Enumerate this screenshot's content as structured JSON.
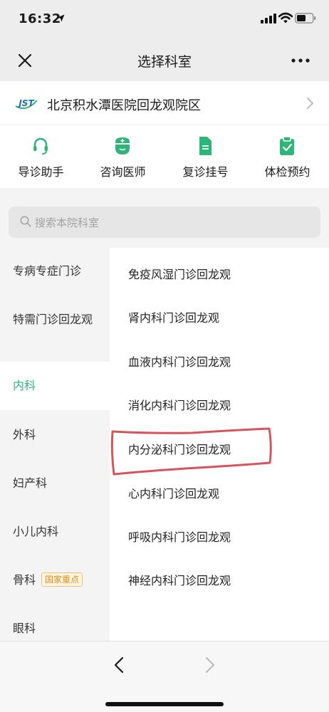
{
  "status": {
    "time": "16:32"
  },
  "nav": {
    "title": "选择科室"
  },
  "hospital": {
    "name": "北京积水潭医院回龙观院区",
    "logo_text": "JST"
  },
  "services": [
    {
      "label": "导诊助手",
      "icon": "headset-icon"
    },
    {
      "label": "咨询医师",
      "icon": "doctor-icon"
    },
    {
      "label": "复诊挂号",
      "icon": "document-icon"
    },
    {
      "label": "体检预约",
      "icon": "clipboard-check-icon"
    }
  ],
  "search": {
    "placeholder": "搜索本院科室"
  },
  "departments": [
    {
      "label": "专病专症门诊"
    },
    {
      "label": "特需门诊回龙观"
    },
    {
      "label": "内科",
      "active": true
    },
    {
      "label": "外科"
    },
    {
      "label": "妇产科"
    },
    {
      "label": "小儿内科"
    },
    {
      "label": "骨科",
      "badge": "国家重点"
    },
    {
      "label": "眼科"
    }
  ],
  "clinics": [
    "免疫风湿门诊回龙观",
    "肾内科门诊回龙观",
    "血液内科门诊回龙观",
    "消化内科门诊回龙观",
    "内分泌科门诊回龙观",
    "心内科门诊回龙观",
    "呼吸内科门诊回龙观",
    "神经内科门诊回龙观"
  ],
  "colors": {
    "accent": "#2fb57a",
    "badge": "#e08a1e",
    "highlight": "#d9535f"
  }
}
